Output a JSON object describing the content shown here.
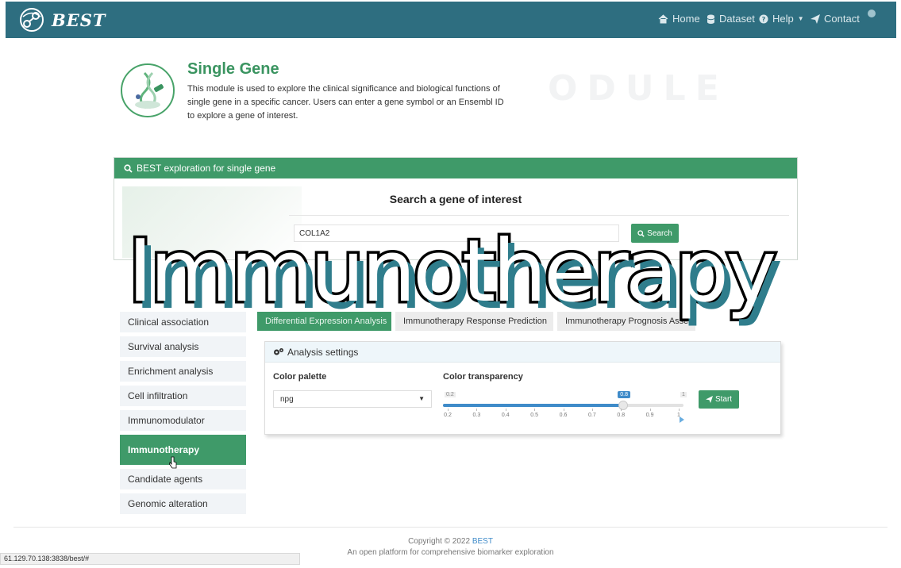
{
  "navbar": {
    "brand": "BEST",
    "items": [
      {
        "label": "Home",
        "icon": "home-icon"
      },
      {
        "label": "Dataset",
        "icon": "database-icon"
      },
      {
        "label": "Help",
        "icon": "question-circle-icon"
      },
      {
        "label": "Contact",
        "icon": "paper-plane-icon"
      }
    ]
  },
  "module": {
    "title": "Single Gene",
    "description": "This module is used to explore the clinical significance and biological functions of single gene in a specific cancer. Users can enter a gene symbol or an Ensembl ID to explore a gene of interest.",
    "watermark": "ODULE"
  },
  "panel": {
    "header": "BEST exploration for single gene",
    "search_title": "Search a gene of interest",
    "search_value": "COL1A2",
    "search_button": "Search"
  },
  "sidebar": {
    "items": [
      {
        "label": "Clinical association"
      },
      {
        "label": "Survival analysis"
      },
      {
        "label": "Enrichment analysis"
      },
      {
        "label": "Cell infiltration"
      },
      {
        "label": "Immunomodulator"
      },
      {
        "label": "Immunotherapy",
        "active": true
      },
      {
        "label": "Candidate agents"
      },
      {
        "label": "Genomic alteration"
      }
    ]
  },
  "tabs": [
    {
      "label": "Differential Expression Analysis",
      "active": true
    },
    {
      "label": "Immunotherapy Response Prediction"
    },
    {
      "label": "Immunotherapy Prognosis Assessi"
    }
  ],
  "analysis": {
    "header": "Analysis settings",
    "palette_label": "Color palette",
    "palette_value": "npg",
    "transparency_label": "Color transparency",
    "slider_min": "0.2",
    "slider_max": "1",
    "slider_value": "0.8",
    "slider_fraction": 0.75,
    "ticks": [
      "0.2",
      "0.3",
      "0.4",
      "0.5",
      "0.6",
      "0.7",
      "0.8",
      "0.9",
      "1"
    ],
    "start_button": "Start"
  },
  "overlay": {
    "title": "Immunotherapy"
  },
  "footer": {
    "copyright_prefix": "Copyright © 2022 ",
    "copyright_brand": "BEST",
    "subtitle": "An open platform for comprehensive biomarker exploration"
  },
  "status_bar": {
    "url": "61.129.70.138:3838/best/#"
  },
  "colors": {
    "navbar": "#2e6e80",
    "accent_green": "#3f9a69",
    "slider_blue": "#3f8bc9"
  }
}
